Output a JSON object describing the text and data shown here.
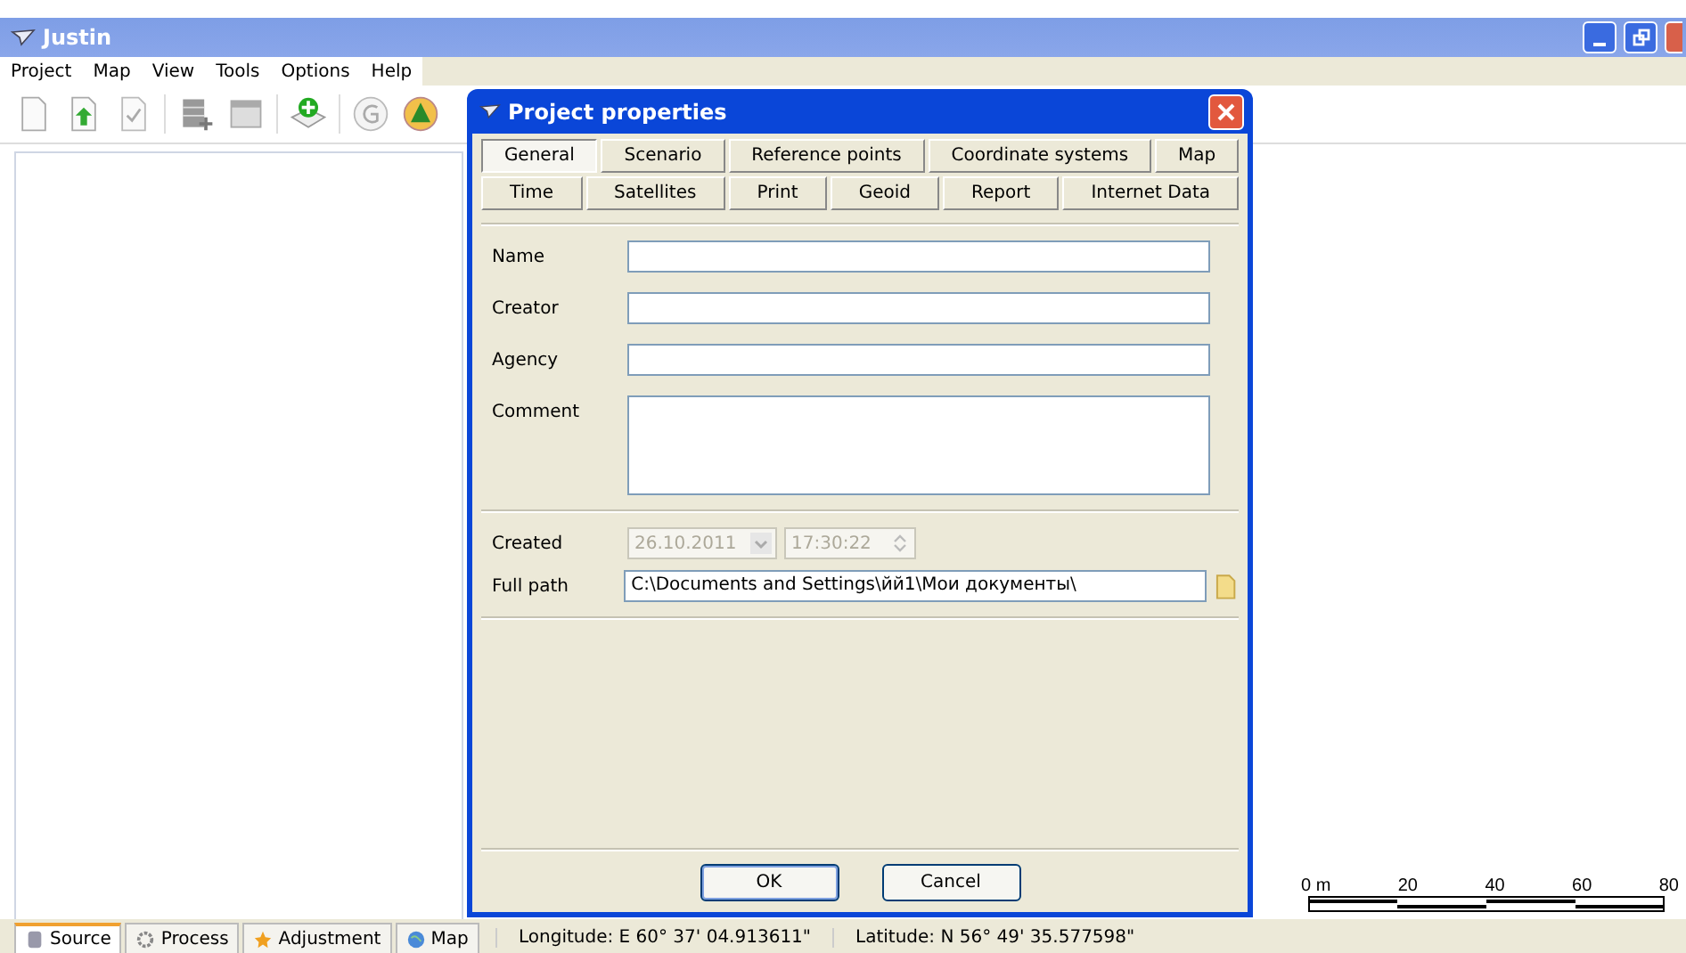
{
  "window": {
    "title": "Justin"
  },
  "menu": [
    "Project",
    "Map",
    "View",
    "Tools",
    "Options",
    "Help"
  ],
  "dialog": {
    "title": "Project properties",
    "tab_rows": [
      [
        {
          "label": "General",
          "selected": true
        },
        {
          "label": "Scenario",
          "selected": false
        },
        {
          "label": "Reference points",
          "selected": false
        },
        {
          "label": "Coordinate systems",
          "selected": false
        },
        {
          "label": "Map",
          "selected": false
        }
      ],
      [
        {
          "label": "Time",
          "selected": false
        },
        {
          "label": "Satellites",
          "selected": false
        },
        {
          "label": "Print",
          "selected": false
        },
        {
          "label": "Geoid",
          "selected": false
        },
        {
          "label": "Report",
          "selected": false
        },
        {
          "label": "Internet Data",
          "selected": false
        }
      ]
    ],
    "fields": [
      {
        "label": "Name",
        "kind": "line"
      },
      {
        "label": "Creator",
        "kind": "line"
      },
      {
        "label": "Agency",
        "kind": "line"
      },
      {
        "label": "Comment",
        "kind": "area"
      }
    ],
    "created": {
      "label": "Created",
      "date": "26.10.2011",
      "time": "17:30:22",
      "disabled": true
    },
    "full_path": {
      "label": "Full path",
      "value": "C:\\Documents and Settings\\йй1\\Мои документы\\"
    },
    "buttons": [
      "OK",
      "Cancel"
    ]
  },
  "scale_bar": {
    "labels": [
      "0 m",
      "20",
      "40",
      "60",
      "80"
    ]
  },
  "bottom_tabs": [
    {
      "label": "Source",
      "selected": true
    },
    {
      "label": "Process",
      "selected": false
    },
    {
      "label": "Adjustment",
      "selected": false
    },
    {
      "label": "Map",
      "selected": false
    }
  ],
  "status_bar": [
    "Longitude: E 60° 37' 04.913611\"",
    "Latitude: N 56° 49' 35.577598\""
  ]
}
